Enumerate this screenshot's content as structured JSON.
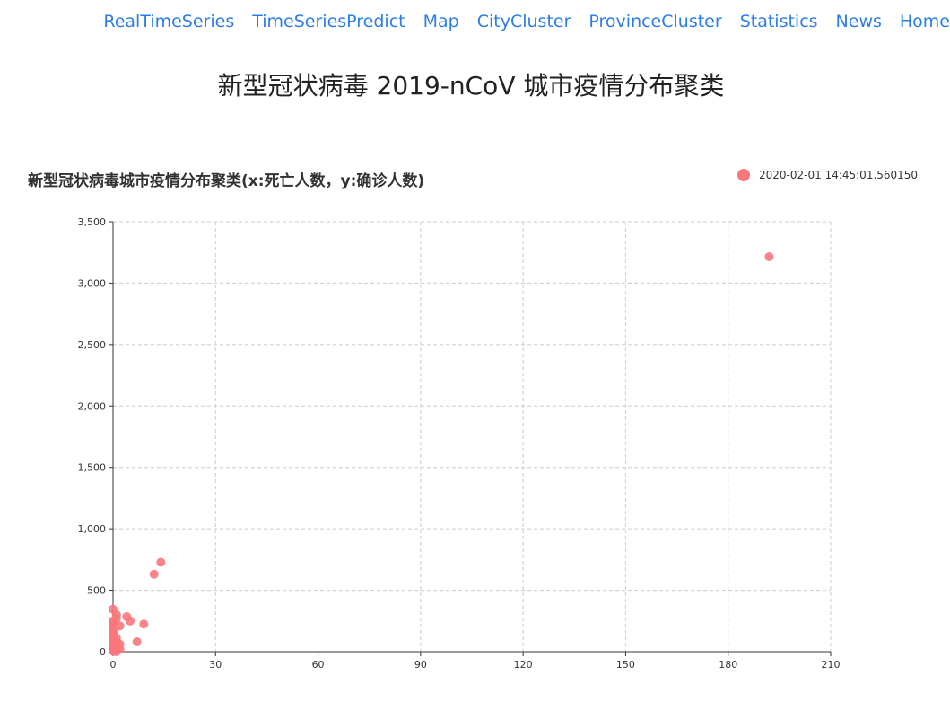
{
  "nav": {
    "items": [
      "RealTimeSeries",
      "TimeSeriesPredict",
      "Map",
      "CityCluster",
      "ProvinceCluster",
      "Statistics",
      "News",
      "Home"
    ]
  },
  "page_title": "新型冠状病毒 2019-nCoV 城市疫情分布聚类",
  "colors": {
    "accent": "#2b7de9",
    "point": "#f8777c",
    "grid": "#cccccc",
    "axis": "#333333"
  },
  "chart_data": {
    "type": "scatter",
    "title": "新型冠状病毒城市疫情分布聚类(x:死亡人数，y:确诊人数)",
    "xlabel": "",
    "ylabel": "",
    "xlim": [
      0,
      210
    ],
    "ylim": [
      0,
      3500
    ],
    "xticks": [
      0,
      30,
      60,
      90,
      120,
      150,
      180,
      210
    ],
    "yticks": [
      0,
      500,
      1000,
      1500,
      2000,
      2500,
      3000,
      3500
    ],
    "xtick_labels": [
      "0",
      "30",
      "60",
      "90",
      "120",
      "150",
      "180",
      "210"
    ],
    "ytick_labels": [
      "0",
      "500",
      "1,000",
      "1,500",
      "2,000",
      "2,500",
      "3,000",
      "3,500"
    ],
    "grid": true,
    "legend_position": "top-right",
    "series": [
      {
        "name": "2020-02-01 14:45:01.560150",
        "points": [
          [
            192,
            3215
          ],
          [
            14,
            727
          ],
          [
            12,
            630
          ],
          [
            9,
            225
          ],
          [
            7,
            80
          ],
          [
            5,
            250
          ],
          [
            4,
            285
          ],
          [
            2,
            210
          ],
          [
            1,
            300
          ],
          [
            1,
            270
          ],
          [
            0,
            345
          ],
          [
            0,
            250
          ],
          [
            0,
            230
          ],
          [
            0,
            200
          ],
          [
            0,
            170
          ],
          [
            0,
            150
          ],
          [
            0,
            120
          ],
          [
            0,
            100
          ],
          [
            0,
            85
          ],
          [
            0,
            70
          ],
          [
            0,
            55
          ],
          [
            0,
            40
          ],
          [
            0,
            25
          ],
          [
            0,
            10
          ],
          [
            0,
            5
          ],
          [
            1,
            110
          ],
          [
            1,
            80
          ],
          [
            1,
            50
          ],
          [
            1,
            30
          ],
          [
            1,
            15
          ],
          [
            2,
            60
          ],
          [
            2,
            20
          ],
          [
            0,
            60
          ],
          [
            1,
            0
          ],
          [
            0,
            140
          ]
        ]
      }
    ]
  }
}
